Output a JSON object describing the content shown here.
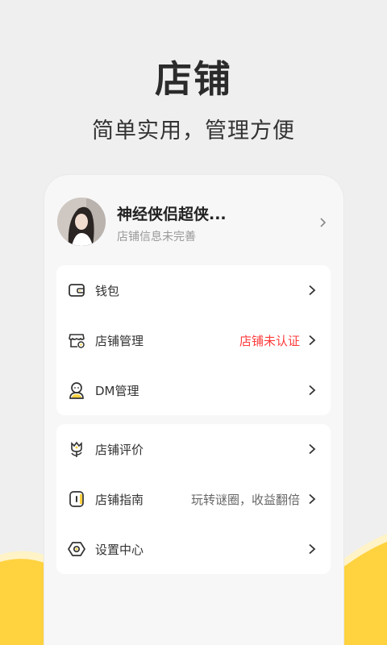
{
  "hero": {
    "title": "店铺",
    "subtitle": "简单实用，管理方便"
  },
  "profile": {
    "name": "神经侠侣超侠...",
    "status": "店铺信息未完善",
    "avatar_icon": "user-photo"
  },
  "menu_group_1": [
    {
      "label": "钱包",
      "icon": "wallet-icon",
      "value": ""
    },
    {
      "label": "店铺管理",
      "icon": "store-icon",
      "value": "店铺未认证",
      "value_color": "#ff3b3b"
    },
    {
      "label": "DM管理",
      "icon": "person-icon",
      "value": ""
    }
  ],
  "menu_group_2": [
    {
      "label": "店铺评价",
      "icon": "flower-icon",
      "value": ""
    },
    {
      "label": "店铺指南",
      "icon": "guide-icon",
      "value": "玩转谜圈，收益翻倍",
      "value_color": "#666666"
    },
    {
      "label": "设置中心",
      "icon": "settings-icon",
      "value": ""
    }
  ],
  "colors": {
    "background": "#efefef",
    "accent_yellow": "#ffd23f",
    "alert_red": "#ff3b3b"
  }
}
